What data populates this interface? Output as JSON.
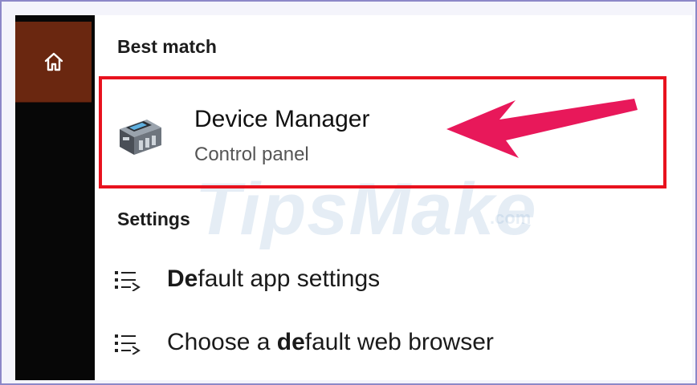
{
  "sidebar": {
    "home_icon": "home-icon"
  },
  "search_results": {
    "best_match_header": "Best match",
    "best_match": {
      "title": "Device Manager",
      "subtitle": "Control panel",
      "icon": "device-manager-icon"
    },
    "settings_header": "Settings",
    "settings_items": [
      {
        "prefix": "",
        "bold": "De",
        "rest": "fault app settings",
        "icon": "settings-list-icon"
      },
      {
        "prefix": "Choose a ",
        "bold": "de",
        "rest": "fault web browser",
        "icon": "settings-list-icon"
      }
    ]
  },
  "annotation": {
    "highlight_color": "#e8121e",
    "arrow_color": "#e8185a"
  },
  "watermark": {
    "text": "TipsMake",
    "suffix": ".com"
  }
}
